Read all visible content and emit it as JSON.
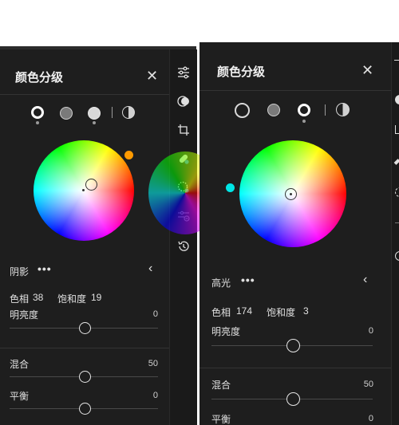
{
  "left_panel": {
    "title": "颜色分级",
    "close": "✕",
    "section": "阴影",
    "more": "•••",
    "collapse": "‹",
    "hue_label": "色相",
    "hue_value": "38",
    "sat_label": "饱和度",
    "sat_value": "19",
    "lum_label": "明亮度",
    "lum_value": "0",
    "lum_level": 0.5,
    "blend_label": "混合",
    "blend_value": "50",
    "blend_level": 0.5,
    "balance_label": "平衡",
    "balance_value": "0",
    "balance_level": 0.5,
    "tint_color": "#ff9a00",
    "active_mode": 0
  },
  "right_panel": {
    "title": "颜色分级",
    "close": "✕",
    "section": "高光",
    "more": "•••",
    "collapse": "‹",
    "hue_label": "色相",
    "hue_value": "174",
    "sat_label": "饱和度",
    "sat_value": "3",
    "lum_label": "明亮度",
    "lum_value": "0",
    "lum_level": 0.5,
    "blend_label": "混合",
    "blend_value": "50",
    "blend_level": 0.5,
    "balance_label": "平衡",
    "balance_value": "0",
    "tint_color": "#00e6e6",
    "active_mode": 2
  },
  "toolbar_icons": [
    "sliders-icon",
    "mask-icon",
    "crop-icon",
    "healing-icon",
    "radial-selection-icon",
    "presets-icon",
    "history-icon"
  ],
  "colors": {
    "panel_bg": "#1e1e1e",
    "toolbar_bg": "#1a1a1a",
    "text": "#e6e6e6"
  }
}
